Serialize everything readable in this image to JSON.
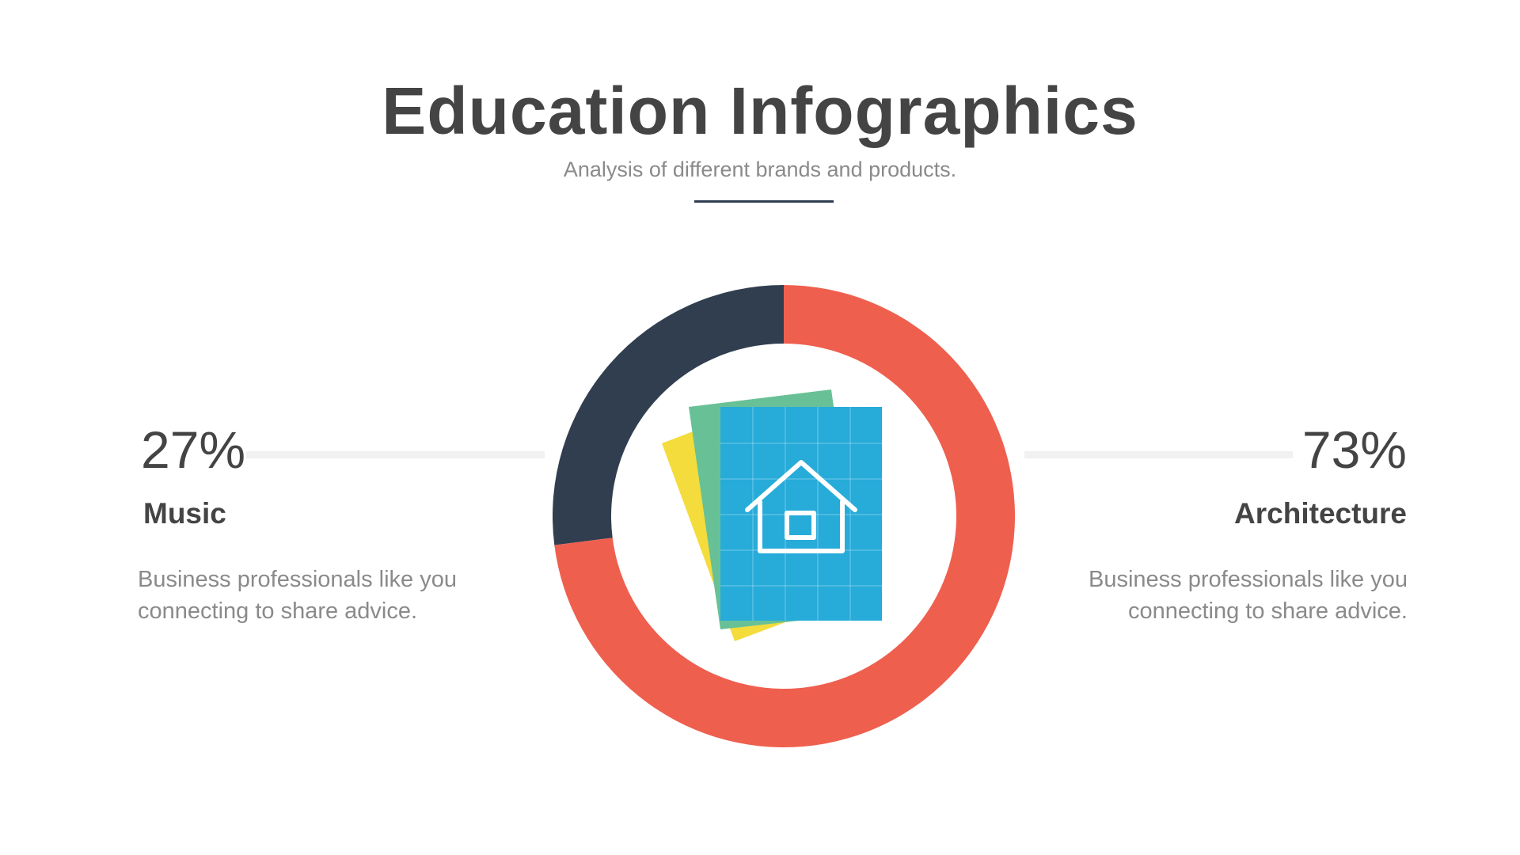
{
  "header": {
    "title": "Education Infographics",
    "subtitle": "Analysis of different brands and products."
  },
  "left": {
    "percent": "27%",
    "label": "Music",
    "description": "Business professionals like you connecting to share advice."
  },
  "right": {
    "percent": "73%",
    "label": "Architecture",
    "description": "Business professionals like you connecting to share advice."
  },
  "icon": "house-blueprint-icon",
  "colors": {
    "title": "#444444",
    "body_text": "#8a8a8a",
    "rule": "#2f3e52",
    "connector": "#f1f1f1",
    "music": "#313e50",
    "architecture": "#ef5f4e",
    "paper_yellow": "#f4dc3c",
    "paper_green": "#68c196",
    "paper_blue": "#27abd9"
  },
  "chart_data": {
    "type": "pie",
    "style": "donut",
    "categories": [
      "Music",
      "Architecture"
    ],
    "values": [
      27,
      73
    ],
    "colors": [
      "#313e50",
      "#ef5f4e"
    ]
  }
}
